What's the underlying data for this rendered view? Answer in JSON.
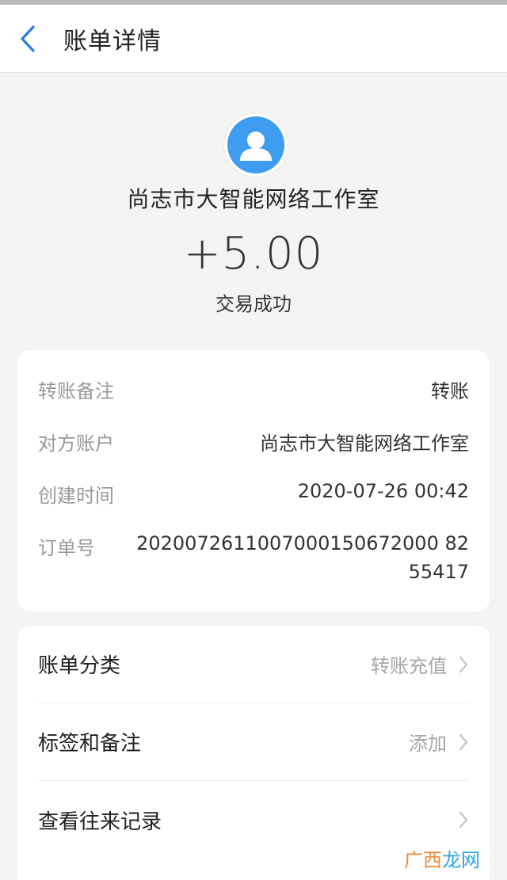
{
  "nav": {
    "title": "账单详情"
  },
  "hero": {
    "merchant": "尚志市大智能网络工作室",
    "amount": "+5.00",
    "status": "交易成功"
  },
  "details": [
    {
      "label": "转账备注",
      "value": "转账"
    },
    {
      "label": "对方账户",
      "value": "尚志市大智能网络工作室"
    },
    {
      "label": "创建时间",
      "value": "2020-07-26 00:42"
    },
    {
      "label": "订单号",
      "value": "2020072611007000150672000 8255417"
    }
  ],
  "actions": [
    {
      "label": "账单分类",
      "hint": "转账充值"
    },
    {
      "label": "标签和备注",
      "hint": "添加"
    },
    {
      "label": "查看往来记录",
      "hint": ""
    }
  ],
  "watermark": {
    "part1": "广西",
    "part2": "龙网"
  },
  "colors": {
    "avatar": "#3e9df0",
    "back_icon": "#2a7fdb"
  }
}
